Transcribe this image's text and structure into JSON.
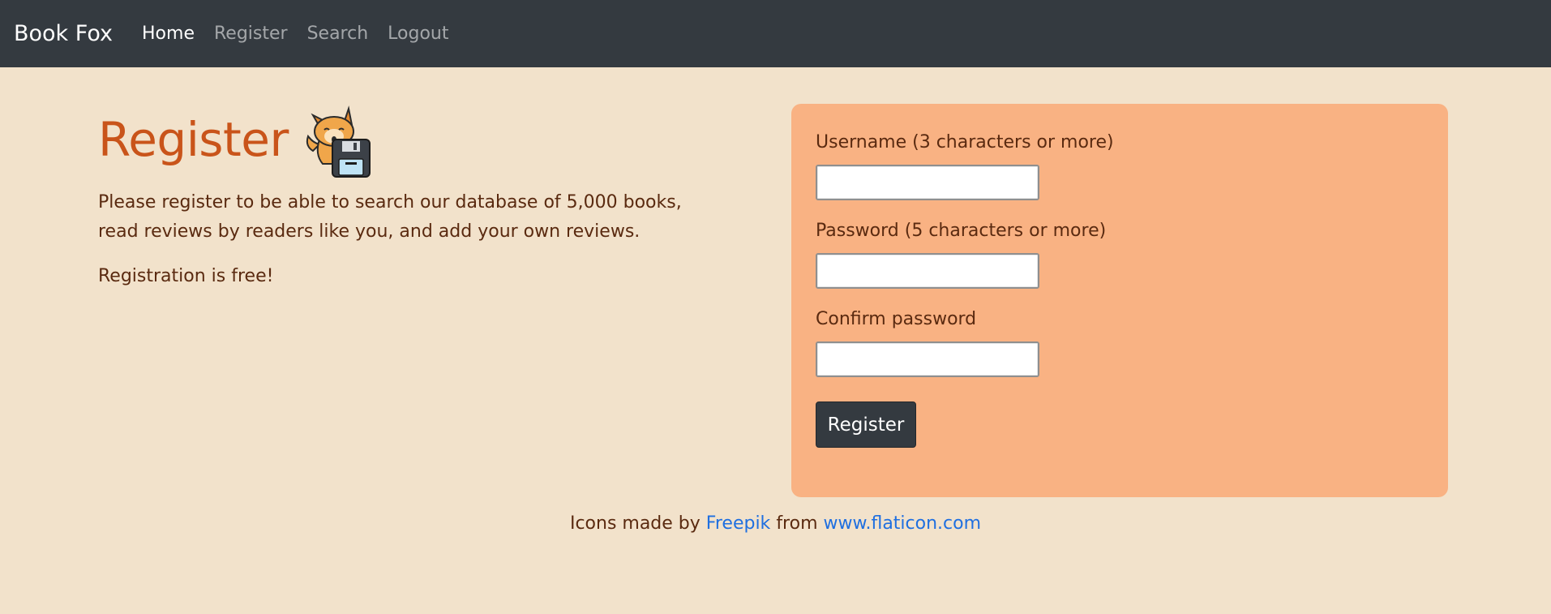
{
  "nav": {
    "brand": "Book Fox",
    "items": [
      {
        "label": "Home",
        "active": true
      },
      {
        "label": "Register",
        "active": false
      },
      {
        "label": "Search",
        "active": false
      },
      {
        "label": "Logout",
        "active": false
      }
    ]
  },
  "main": {
    "title": "Register",
    "icon": "fox-with-floppy-disk-icon",
    "intro": "Please register to be able to search our database of 5,000 books, read reviews by readers like you, and add your own reviews.",
    "free_note": "Registration is free!"
  },
  "form": {
    "username_label": "Username (3 characters or more)",
    "username_value": "",
    "password_label": "Password (5 characters or more)",
    "password_value": "",
    "confirm_label": "Confirm password",
    "confirm_value": "",
    "submit_label": "Register"
  },
  "footer": {
    "prefix": "Icons made by",
    "author_link": "Freepik",
    "middle": "from",
    "site_link": "www.flaticon.com"
  },
  "colors": {
    "navbar": "#343a40",
    "background": "#f2e2cb",
    "card": "#f9b283",
    "title": "#c9541a",
    "link": "#1f6fe0"
  }
}
